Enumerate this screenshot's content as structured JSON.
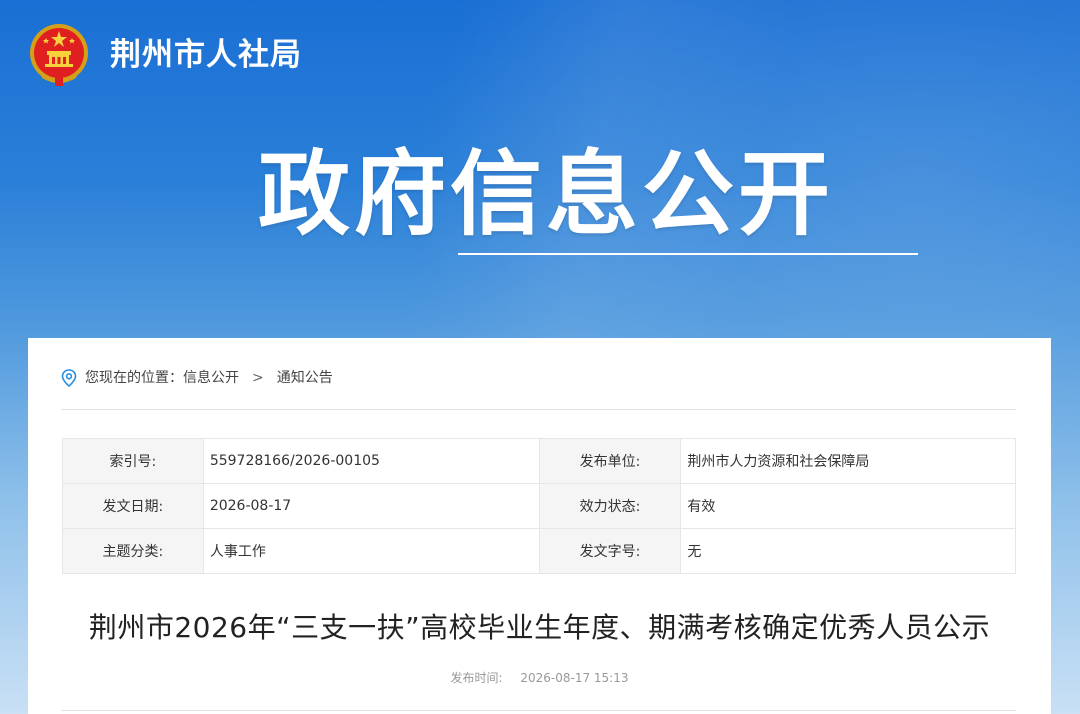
{
  "header": {
    "site_name": "荆州市人社局",
    "hero_title": "政府信息公开",
    "emblem_icon": "national-emblem-icon"
  },
  "breadcrumb": {
    "prefix": "您现在的位置：",
    "items": [
      "信息公开",
      "通知公告"
    ],
    "separator": ">"
  },
  "meta": {
    "rows": [
      {
        "k1": "索引号:",
        "v1": "559728166/2026-00105",
        "k2": "发布单位:",
        "v2": "荆州市人力资源和社会保障局"
      },
      {
        "k1": "发文日期:",
        "v1": "2026-08-17",
        "k2": "效力状态:",
        "v2": "有效"
      },
      {
        "k1": "主题分类:",
        "v1": "人事工作",
        "k2": "发文字号:",
        "v2": "无"
      }
    ]
  },
  "article": {
    "title": "荆州市2026年“三支一扶”高校毕业生年度、期满考核确定优秀人员公示",
    "pub_label": "发布时间:",
    "pub_time": "2026-08-17 15:13"
  },
  "colors": {
    "banner_top": "#1a6fd4",
    "banner_bottom": "#c9e0f5",
    "accent": "#2a8fe0"
  }
}
